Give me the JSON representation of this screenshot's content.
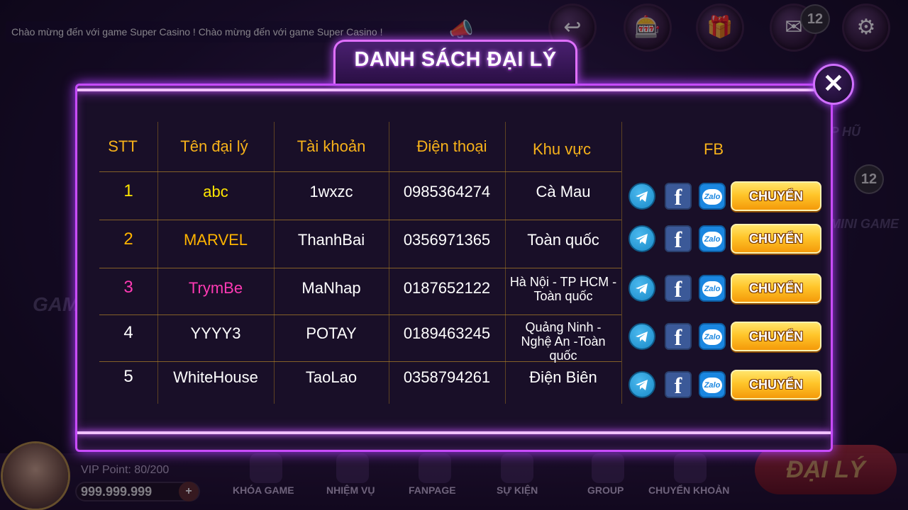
{
  "lobby": {
    "ticker_text": "Chào mừng đến với game Super Casino ! Chào mừng đến với game Super Casino !",
    "mail_badge": "12",
    "minigame_badge": "12",
    "side_left_label": "GAME BÀI",
    "side_right_label_1": "TOP HŨ",
    "side_right_label_2": "MINI GAME",
    "vip_point": "VIP Point: 80/200",
    "coin_balance": "999.999.999",
    "nav": [
      "KHÓA GAME",
      "NHIỆM VỤ",
      "FANPAGE",
      "SỰ KIỆN",
      "GROUP",
      "CHUYỂN KHOẢN"
    ],
    "dai_ly_button": "ĐẠI LÝ"
  },
  "modal": {
    "title": "DANH SÁCH ĐẠI LÝ",
    "close_symbol": "✕",
    "headers": {
      "stt": "STT",
      "name": "Tên đại lý",
      "account": "Tài khoản",
      "phone": "Điện thoại",
      "region": "Khu vực",
      "fb": "FB"
    },
    "rows": [
      {
        "stt": "1",
        "name": "abc",
        "account": "1wxzc",
        "phone": "0985364274",
        "region": "Cà Mau",
        "name_color": "#ffe600",
        "stt_color": "#ffe600"
      },
      {
        "stt": "2",
        "name": "MARVEL",
        "account": "ThanhBai",
        "phone": "0356971365",
        "region": "Toàn quốc",
        "name_color": "#ffb400",
        "stt_color": "#ffb400"
      },
      {
        "stt": "3",
        "name": "TrymBe",
        "account": "MaNhap",
        "phone": "0187652122",
        "region": "Hà Nội - TP HCM -Toàn quốc",
        "name_color": "#ff3ab4",
        "stt_color": "#ff3ab4"
      },
      {
        "stt": "4",
        "name": "YYYY3",
        "account": "POTAY",
        "phone": "0189463245",
        "region": "Quảng Ninh - Nghệ An -Toàn quốc",
        "name_color": "#ffffff",
        "stt_color": "#ffffff"
      },
      {
        "stt": "5",
        "name": "WhiteHouse",
        "account": "TaoLao",
        "phone": "0358794261",
        "region": "Điện Biên",
        "name_color": "#ffffff",
        "stt_color": "#ffffff"
      }
    ],
    "transfer_label": "CHUYỂN",
    "zalo_label": "Zalo",
    "facebook_glyph": "f"
  }
}
